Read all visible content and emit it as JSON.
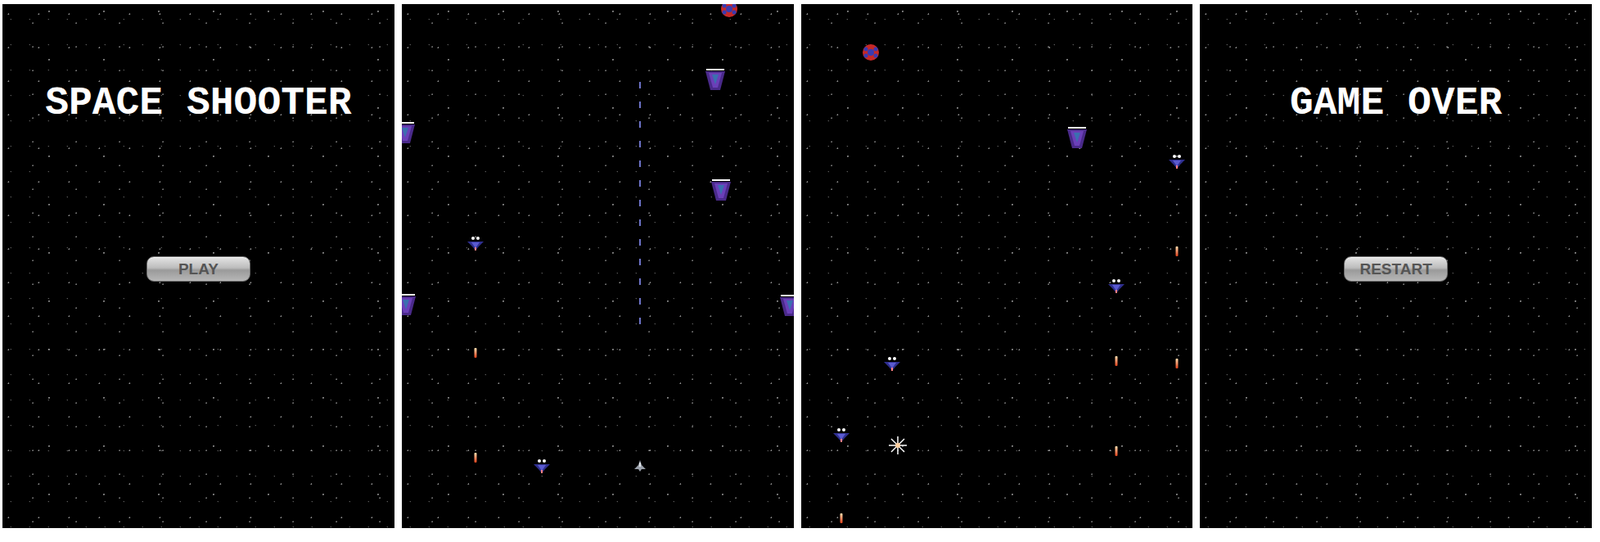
{
  "screens": [
    {
      "kind": "menu",
      "title": "SPACE SHOOTER",
      "button": "PLAY"
    },
    {
      "kind": "play",
      "sprites": [
        {
          "kind": "mine"
        },
        {
          "kind": "heavy"
        },
        {
          "kind": "heavy"
        },
        {
          "kind": "heavy"
        },
        {
          "kind": "heavy"
        },
        {
          "kind": "heavy"
        },
        {
          "kind": "fighter"
        },
        {
          "kind": "fighter"
        },
        {
          "kind": "laser"
        },
        {
          "kind": "player"
        },
        {
          "kind": "bullet"
        },
        {
          "kind": "bullet"
        }
      ]
    },
    {
      "kind": "play",
      "sprites": [
        {
          "kind": "mine"
        },
        {
          "kind": "heavy"
        },
        {
          "kind": "fighter"
        },
        {
          "kind": "fighter"
        },
        {
          "kind": "fighter"
        },
        {
          "kind": "fighter"
        },
        {
          "kind": "explosion"
        },
        {
          "kind": "bullet"
        },
        {
          "kind": "bullet"
        },
        {
          "kind": "bullet"
        },
        {
          "kind": "bullet"
        },
        {
          "kind": "bullet"
        }
      ]
    },
    {
      "kind": "menu",
      "title": "GAME OVER",
      "button": "RESTART"
    }
  ]
}
